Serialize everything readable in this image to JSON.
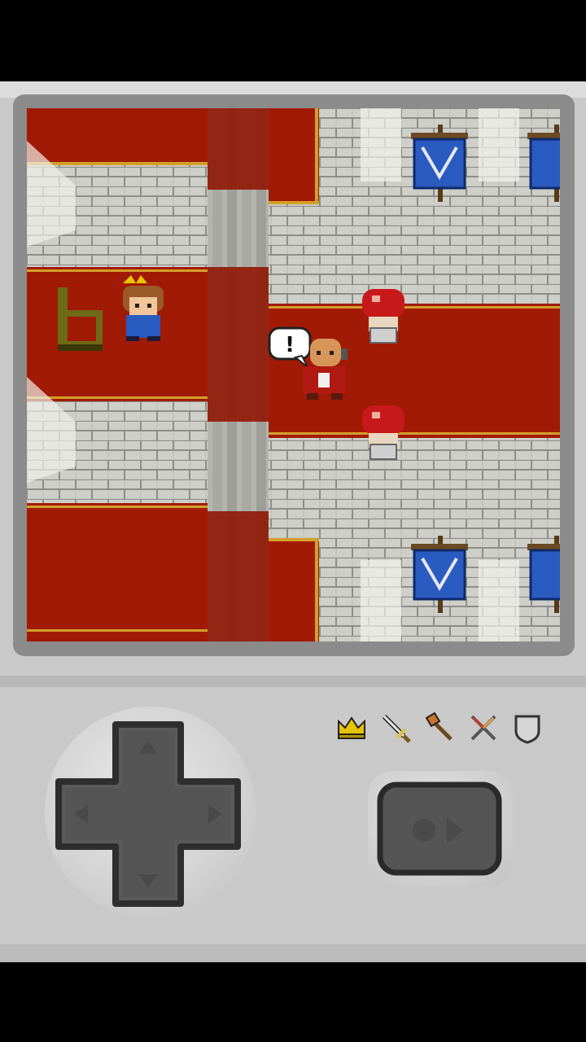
{
  "screen": {
    "speech_bubble_text": "!"
  },
  "items": [
    {
      "name": "crown-icon",
      "color": "#e8c400"
    },
    {
      "name": "sword-icon",
      "color": "#d9c25a"
    },
    {
      "name": "axe-icon",
      "color": "#c8742a"
    },
    {
      "name": "crossed-weapons-icon",
      "color": "#c83a2a"
    },
    {
      "name": "shield-icon",
      "color": "#9a9a9a"
    }
  ],
  "colors": {
    "carpet": "#a11a05",
    "stone": "#c8c8c8",
    "banner": "#2a5bc0",
    "body": "#c9c9c9"
  }
}
